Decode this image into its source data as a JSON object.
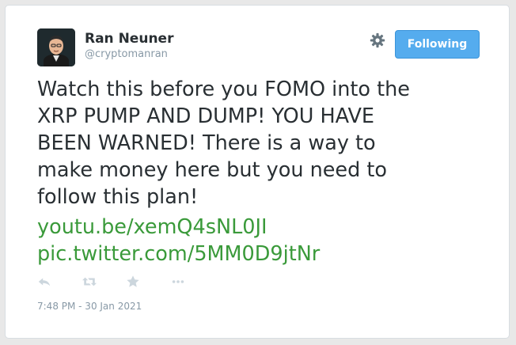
{
  "tweet": {
    "author_name": "Ran Neuner",
    "author_handle": "@cryptomanran",
    "follow_button_label": "Following",
    "text": "Watch this before you FOMO into the\nXRP PUMP AND DUMP! YOU HAVE\nBEEN WARNED! There is a way to\nmake money here but you need to\nfollow this plan!",
    "link_youtube": "youtu.be/xemQ4sNL0JI",
    "link_pic": "pic.twitter.com/5MM0D9jtNr",
    "timestamp": "7:48 PM - 30 Jan 2021"
  },
  "icons": {
    "settings": "gear-icon",
    "reply": "reply-icon",
    "retweet": "retweet-icon",
    "favorite": "star-icon",
    "more": "more-icon"
  },
  "colors": {
    "follow_button": "#55acee",
    "link": "#3a9a3a",
    "text": "#292f33",
    "muted": "#8899a6"
  }
}
